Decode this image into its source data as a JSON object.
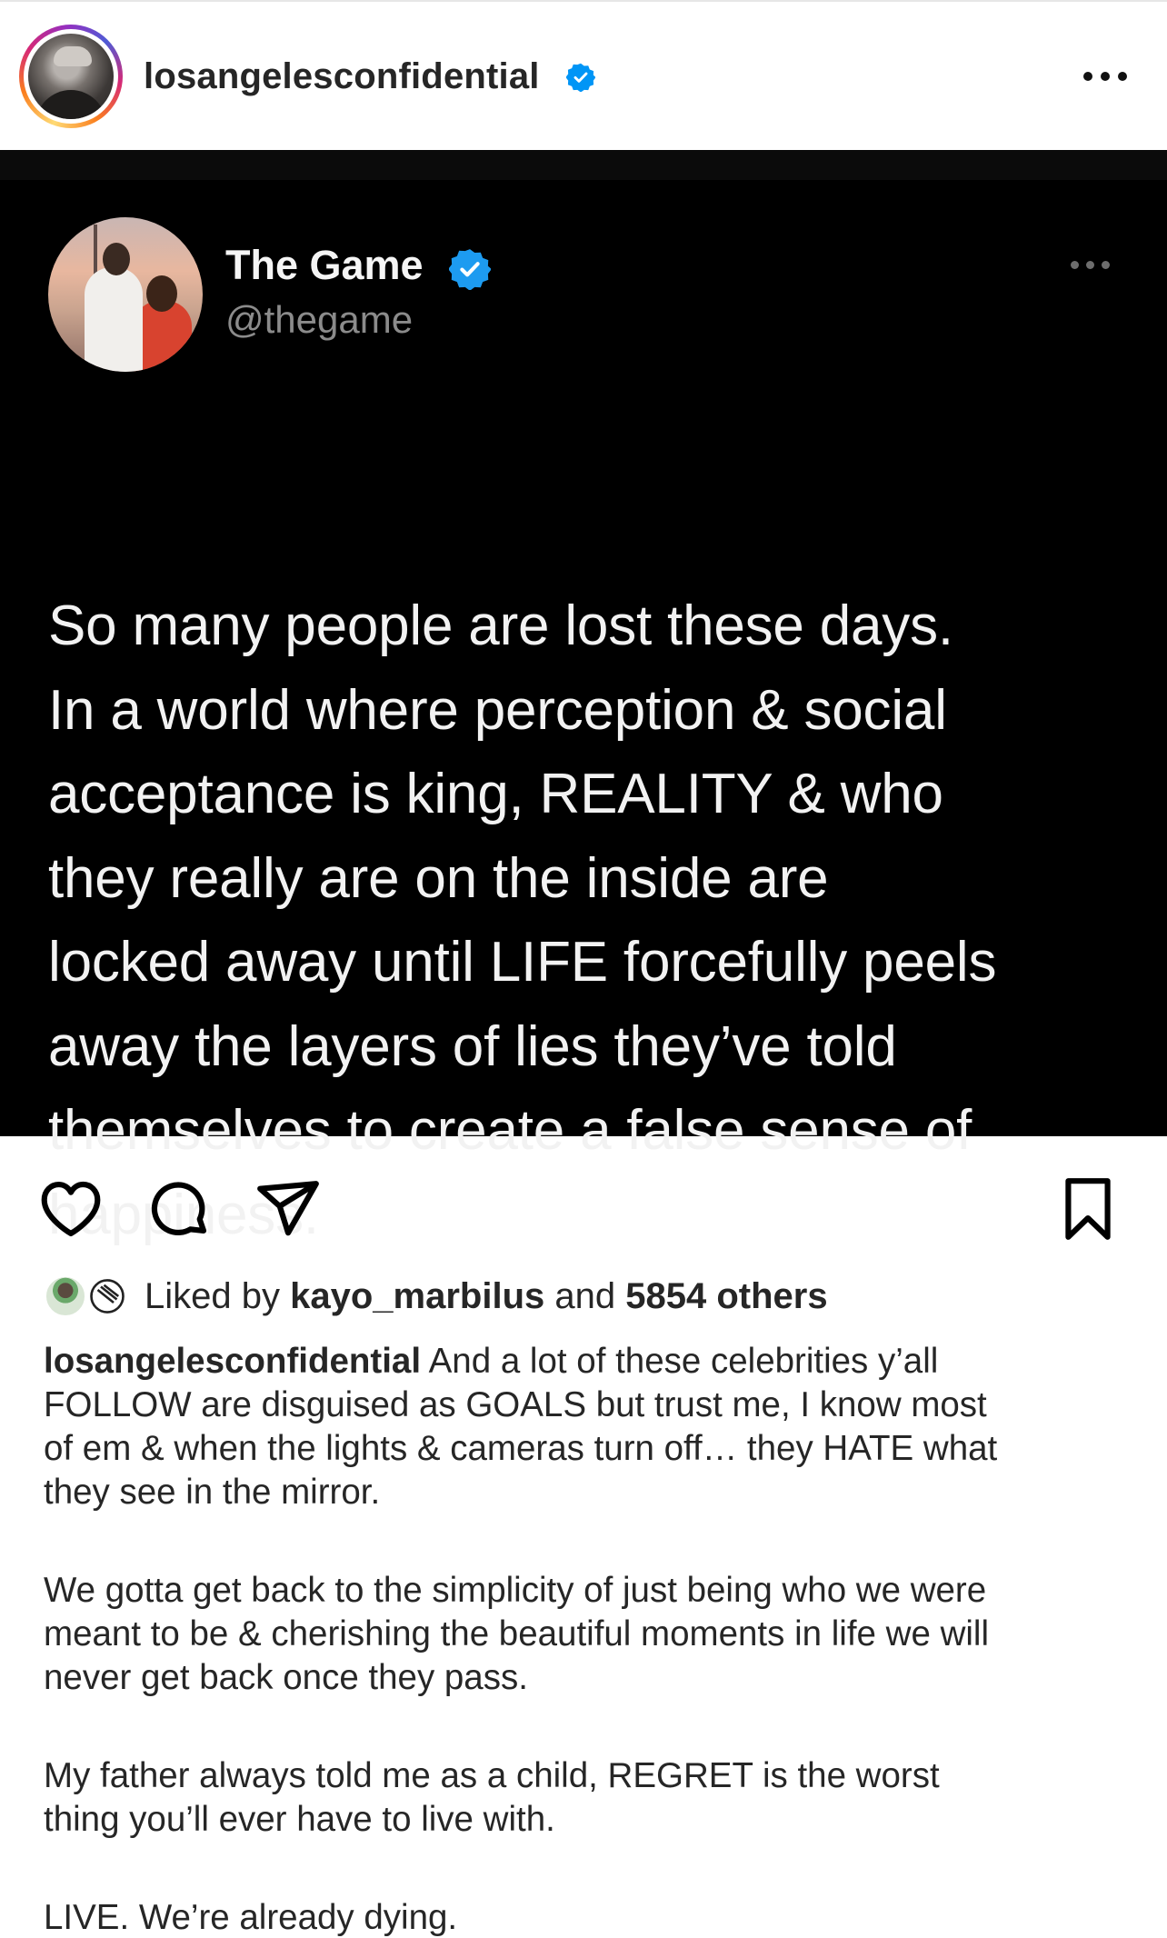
{
  "post": {
    "username": "losangelesconfidential",
    "verified_icon": "verified-badge-icon",
    "more_icon": "more-horizontal-icon"
  },
  "tweet": {
    "name": "The Game",
    "handle": "@thegame",
    "lines": [
      "So many people are lost these days.",
      "In a world where perception & social",
      "acceptance is king, REALITY & who",
      "they really are on the inside are",
      "locked away until LIFE forcefully peels",
      "away the layers of lies they’ve told",
      "themselves to create a false sense of",
      "happiness."
    ]
  },
  "actions": {
    "like_icon": "heart-icon",
    "comment_icon": "comment-icon",
    "share_icon": "send-icon",
    "save_icon": "bookmark-icon"
  },
  "likes": {
    "prefix": "Liked by",
    "user": "kayo_marbilus",
    "and": "and",
    "others": "5854 others"
  },
  "caption": {
    "username": "losangelesconfidential",
    "p1_line1": "And a lot of these celebrities y’all",
    "p1_lines": [
      "FOLLOW are disguised as GOALS but trust me, I know most",
      "of em & when the lights & cameras turn off… they HATE what",
      "they see in the mirror."
    ],
    "p2_lines": [
      "We gotta get back to the simplicity of just being who we were",
      "meant to be & cherishing the beautiful moments in life we will",
      "never get back once they pass."
    ],
    "p3_lines": [
      "My father always told me as a child, REGRET is the worst",
      "thing you’ll ever have to live with."
    ],
    "p4_lines": [
      "LIVE. We’re already dying."
    ]
  },
  "colors": {
    "verified_blue": "#1d9bf0",
    "instagram_verified": "#0095f6",
    "text_primary": "#262626"
  }
}
